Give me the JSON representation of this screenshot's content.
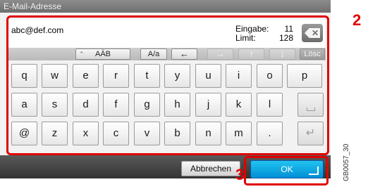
{
  "header": {
    "title": "E-Mail-Adresse"
  },
  "input": {
    "value": "abc@def.com"
  },
  "counter": {
    "entry_label": "Eingabe:",
    "entry_value": "11",
    "limit_label": "Limit:",
    "limit_value": "128"
  },
  "toolbar": {
    "charset_label": "AÄB",
    "case_label": "A/a",
    "delete_label": "Lösc"
  },
  "keyboard": {
    "row1": [
      "q",
      "w",
      "e",
      "r",
      "t",
      "y",
      "u",
      "i",
      "o",
      "p"
    ],
    "row2": [
      "a",
      "s",
      "d",
      "f",
      "g",
      "h",
      "j",
      "k",
      "l"
    ],
    "row3": [
      "@",
      "z",
      "x",
      "c",
      "v",
      "b",
      "n",
      "m",
      "."
    ]
  },
  "footer": {
    "cancel_label": "Abbrechen",
    "ok_label": "OK"
  },
  "callouts": {
    "step2": "2",
    "step3": "3"
  },
  "figure_id": "GB0057_30",
  "colors": {
    "highlight": "#e00000",
    "ok_button": "#0a9fe0",
    "bottom_bar": "#3a3a3a"
  }
}
